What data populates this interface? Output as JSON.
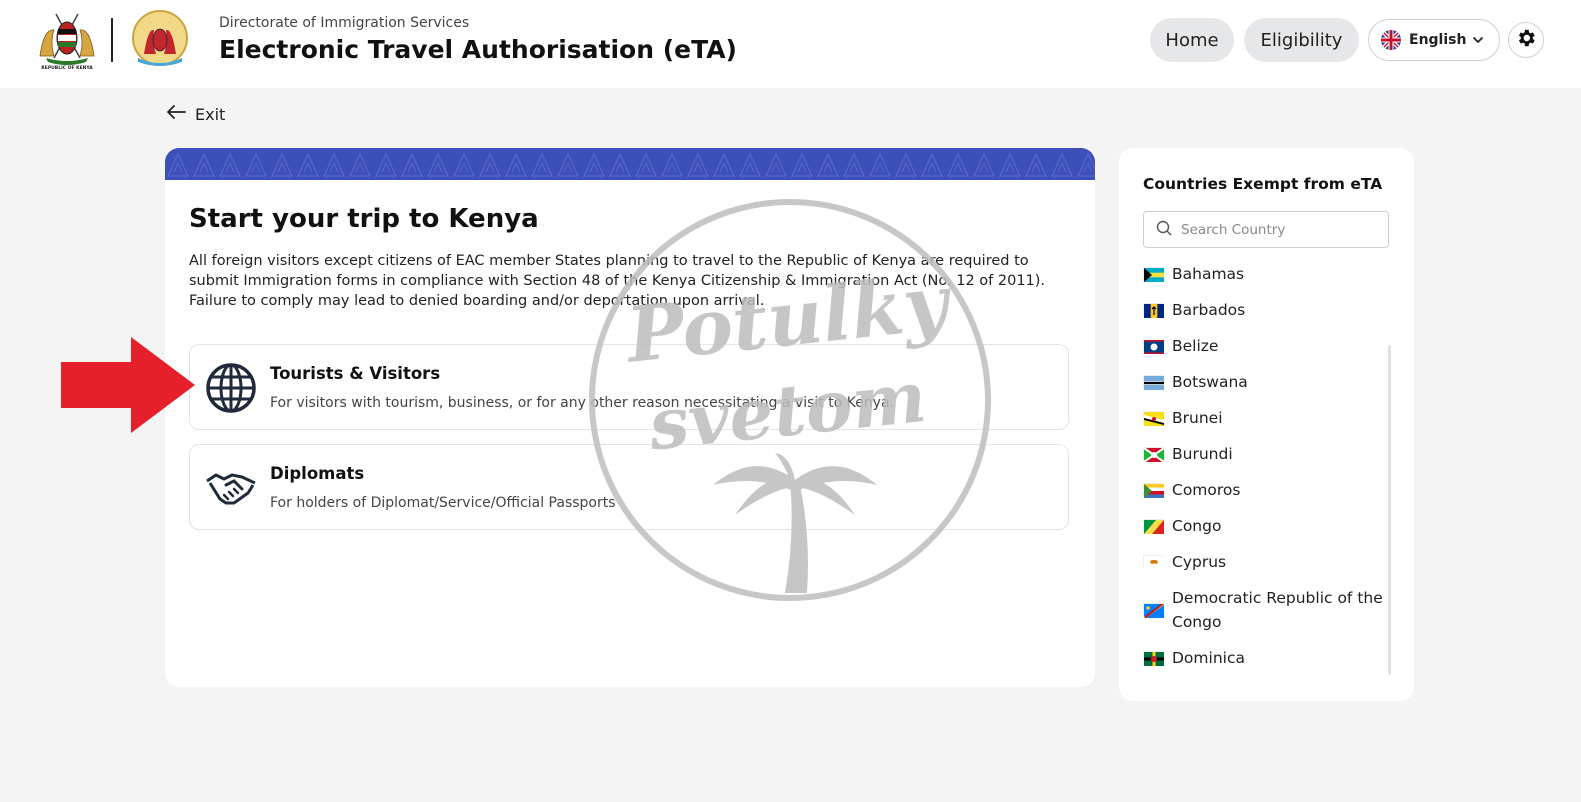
{
  "header": {
    "coat_of_arms_text": "REPUBLIC OF KENYA",
    "department": "Directorate of Immigration Services",
    "title": "Electronic Travel Authorisation (eTA)",
    "nav": {
      "home": "Home",
      "eligibility": "Eligibility"
    },
    "language": {
      "selected": "English",
      "flag_icon": "uk-flag-icon"
    },
    "settings_icon": "gear-icon"
  },
  "exit_label": "Exit",
  "main": {
    "banner_color": "#3d4fb8",
    "title": "Start your trip to Kenya",
    "description": "All foreign visitors except citizens of EAC member States planning to travel to the Republic of Kenya are required to submit Immigration forms in compliance with Section 48 of the Kenya Citizenship & Immigration Act (No. 12 of 2011). Failure to comply may lead to denied boarding and/or deportation upon arrival.",
    "options": [
      {
        "icon": "globe-icon",
        "title": "Tourists & Visitors",
        "description": "For visitors with tourism, business, or for any other reason necessitating a visit to Kenya."
      },
      {
        "icon": "handshake-icon",
        "title": "Diplomats",
        "description": "For holders of Diplomat/Service/Official Passports"
      }
    ]
  },
  "exempt": {
    "title": "Countries Exempt from eTA",
    "search_placeholder": "Search Country",
    "countries": [
      "Bahamas",
      "Barbados",
      "Belize",
      "Botswana",
      "Brunei",
      "Burundi",
      "Comoros",
      "Congo",
      "Cyprus",
      "Democratic Republic of the Congo",
      "Dominica"
    ]
  },
  "watermark": {
    "line1": "Potulky",
    "line2": "svetom"
  },
  "colors": {
    "arrow": "#e5202a",
    "accent": "#3d4fb8"
  }
}
